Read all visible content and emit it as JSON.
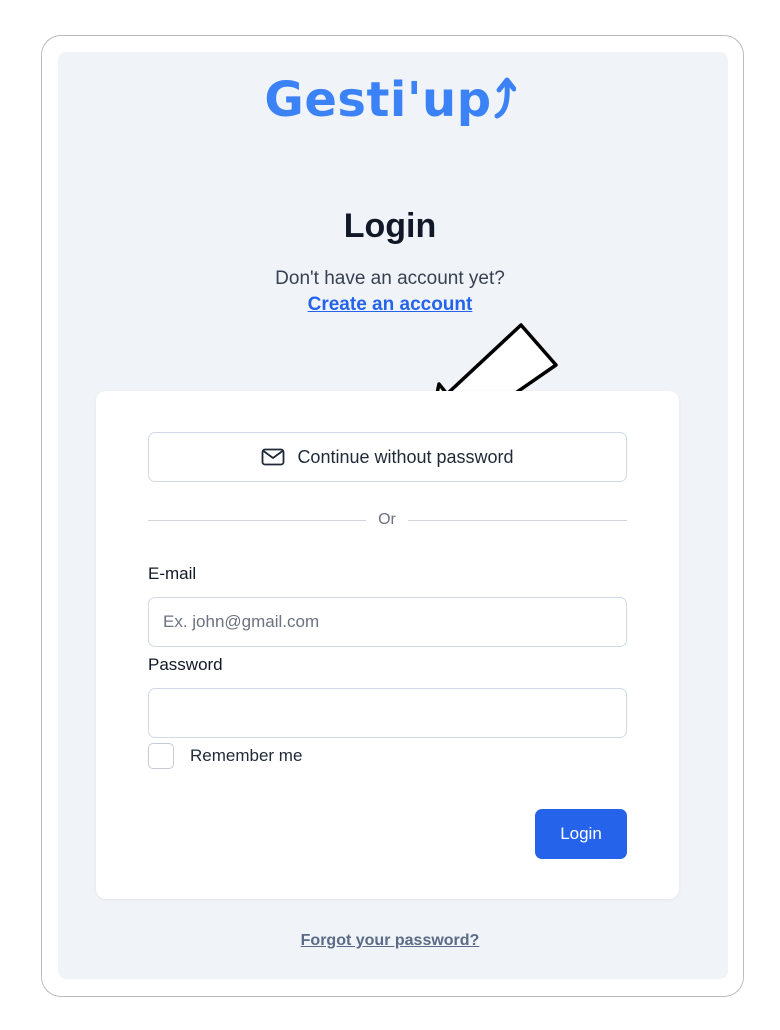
{
  "brand": {
    "name": "Gesti'up",
    "color": "#3b82f6",
    "icon": "upward-arrow-icon"
  },
  "header": {
    "title": "Login",
    "subtitle": "Don't have an account yet?",
    "create_account_link": "Create an account"
  },
  "annotation": {
    "icon": "hand-drawn-arrow-icon"
  },
  "form": {
    "passwordless_button": {
      "label": "Continue without password",
      "icon": "mail-icon"
    },
    "divider_text": "Or",
    "email": {
      "label": "E-mail",
      "placeholder": "Ex. john@gmail.com",
      "value": ""
    },
    "password": {
      "label": "Password",
      "value": ""
    },
    "remember_me": {
      "label": "Remember me",
      "checked": false
    },
    "submit_label": "Login",
    "submit_color": "#2563eb"
  },
  "footer": {
    "forgot_password_link": "Forgot your password?"
  }
}
